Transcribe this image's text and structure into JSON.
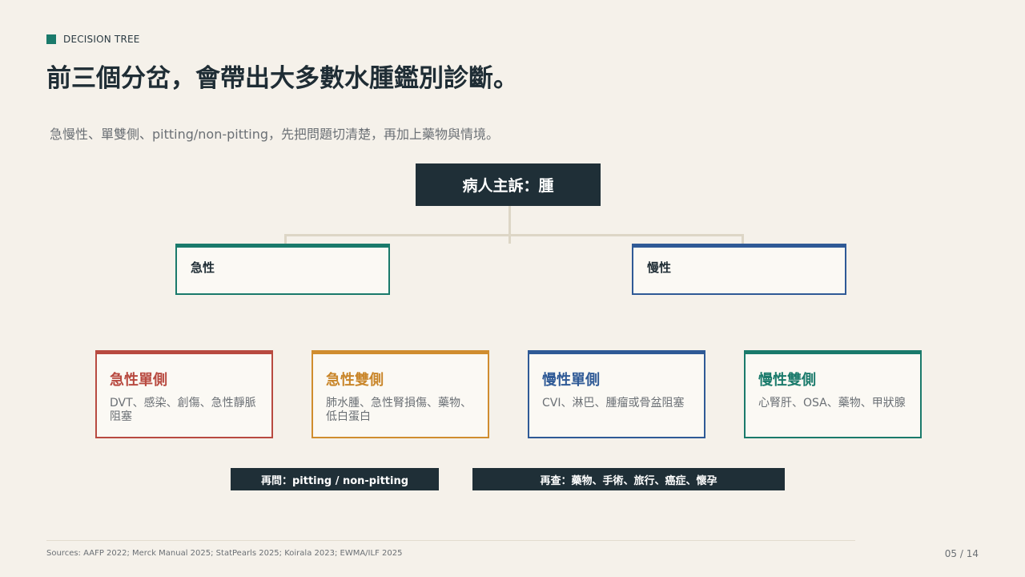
{
  "eyebrow": "DECISION TREE",
  "title": "前三個分岔，會帶出大多數水腫鑑別診斷。",
  "subtitle": "急慢性、單雙側、pitting/non-pitting，先把問題切清楚，再加上藥物與情境。",
  "tree": {
    "root": "病人主訴：腫",
    "branches": [
      "急性",
      "慢性"
    ],
    "leaves": [
      {
        "title": "急性單側",
        "desc": "DVT、感染、創傷、急性靜脈阻塞",
        "color": "#b84a40"
      },
      {
        "title": "急性雙側",
        "desc": "肺水腫、急性腎損傷、藥物、低白蛋白",
        "color": "#c9862a"
      },
      {
        "title": "慢性單側",
        "desc": "CVI、淋巴、腫瘤或骨盆阻塞",
        "color": "#2f5a96"
      },
      {
        "title": "慢性雙側",
        "desc": "心腎肝、OSA、藥物、甲狀腺",
        "color": "#1a7a6b"
      }
    ]
  },
  "followups": [
    "再問：pitting / non-pitting",
    "再查：藥物、手術、旅行、癌症、懷孕"
  ],
  "footer": {
    "sources": "Sources: AAFP 2022; Merck Manual 2025; StatPearls 2025; Koirala 2023; EWMA/ILF 2025",
    "page": "05 / 14"
  },
  "colors": {
    "teal": "#1a7a6b",
    "blue": "#2f5a96",
    "red": "#b84a40",
    "amber": "#c9862a",
    "dark": "#1f2f37"
  }
}
